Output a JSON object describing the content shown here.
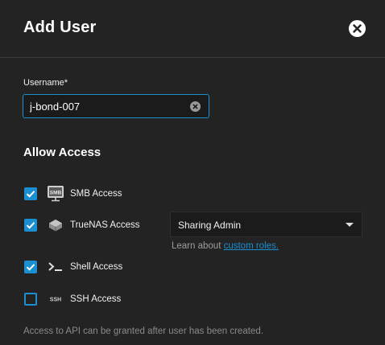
{
  "dialog": {
    "title": "Add User"
  },
  "username": {
    "label": "Username",
    "required_mark": "*",
    "value": "j-bond-007"
  },
  "allow_access": {
    "title": "Allow Access",
    "items": [
      {
        "label": "SMB Access",
        "checked": true,
        "icon": "smb-icon",
        "icon_text": "SMB"
      },
      {
        "label": "TrueNAS Access",
        "checked": true,
        "icon": "truenas-icon"
      },
      {
        "label": "Shell Access",
        "checked": true,
        "icon": "shell-icon"
      },
      {
        "label": "SSH Access",
        "checked": false,
        "icon": "ssh-icon",
        "icon_text": "SSH"
      }
    ],
    "role": {
      "selected": "Sharing Admin",
      "hint_prefix": "Learn about",
      "hint_link": "custom roles."
    },
    "api_note": "Access to API can be granted after user has been created."
  },
  "colors": {
    "background": "#232323",
    "accent": "#1a8fd1",
    "text": "#ffffff",
    "muted": "#9e9e9e"
  }
}
